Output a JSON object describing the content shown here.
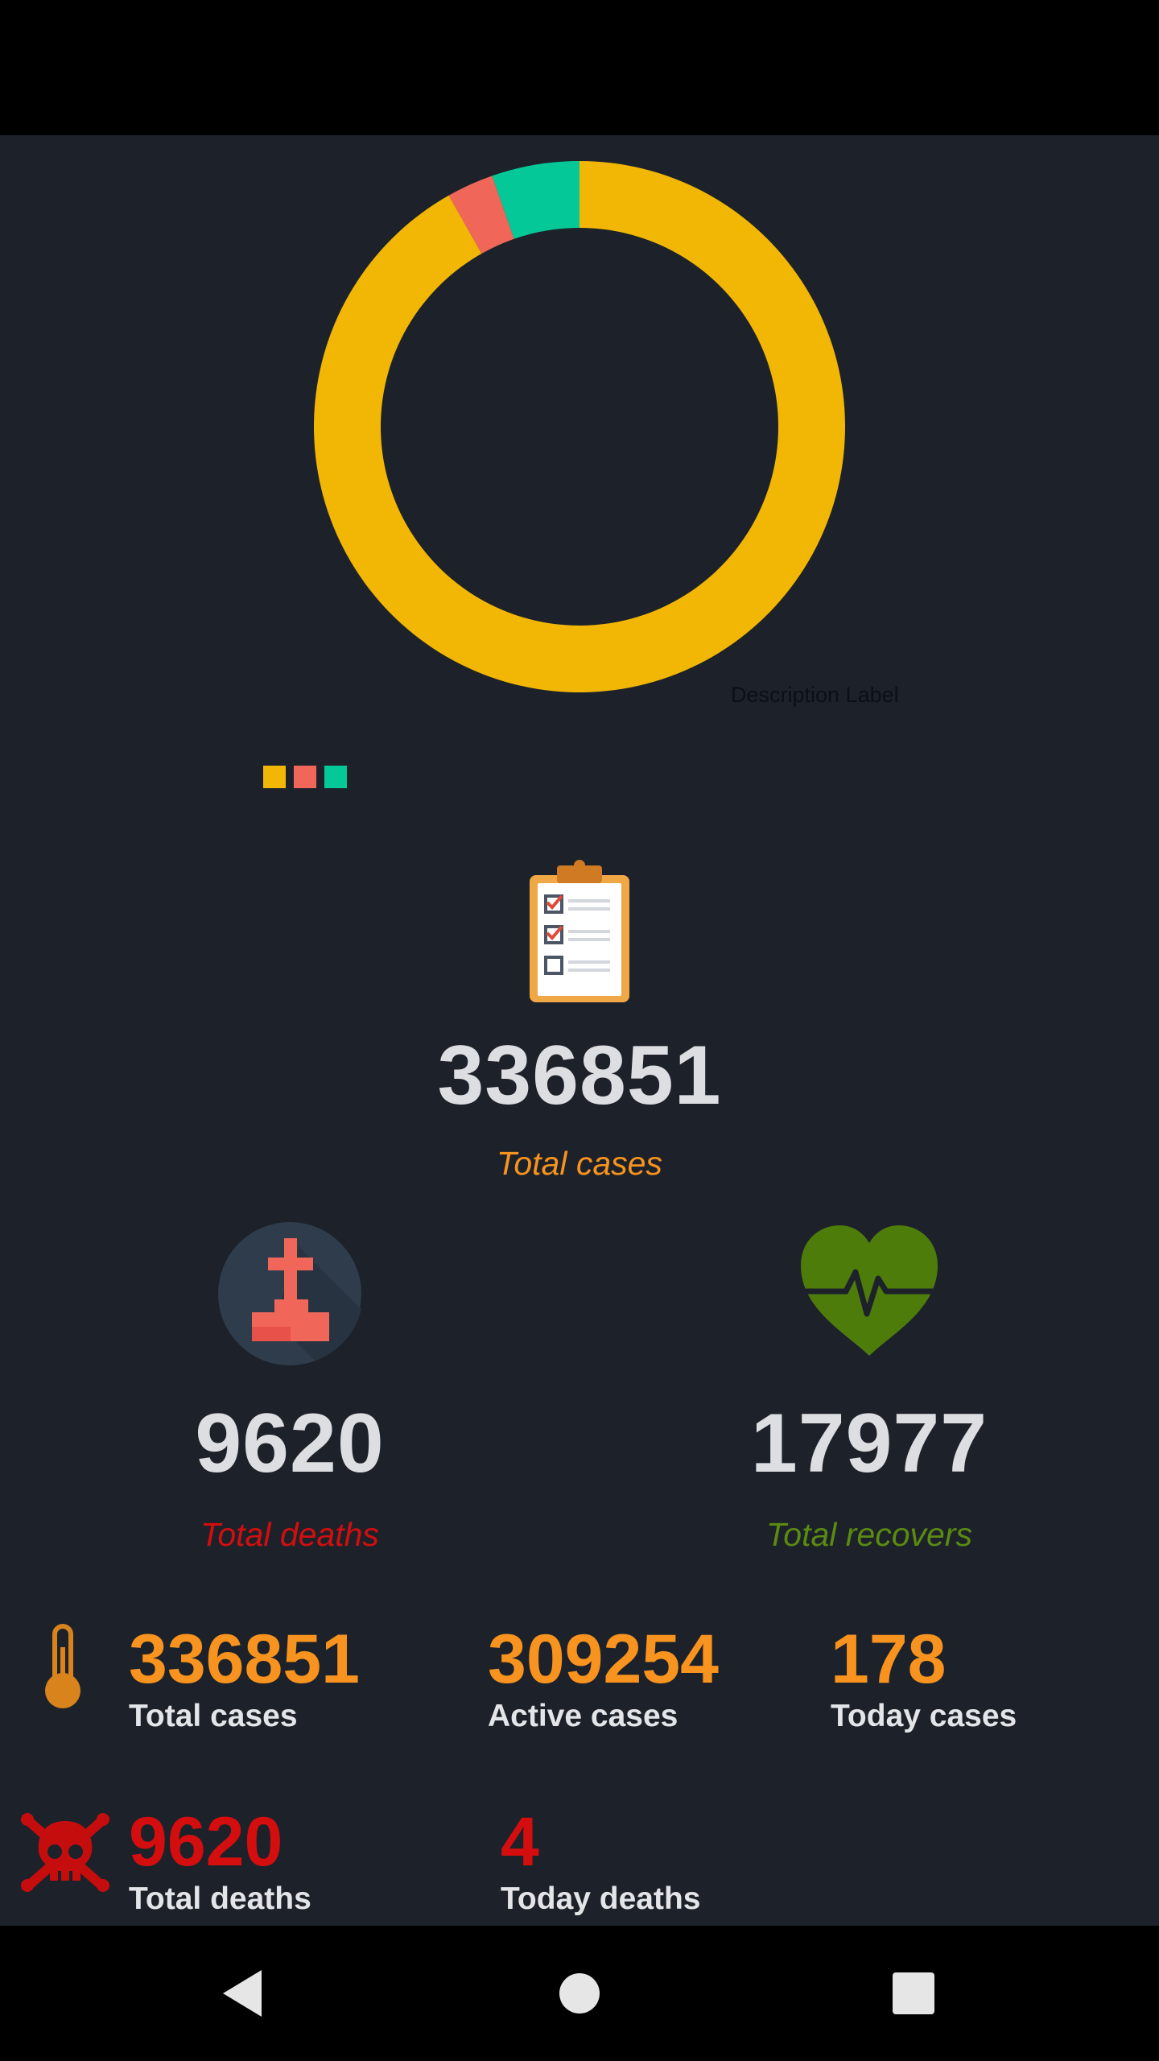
{
  "chart_data": {
    "type": "pie",
    "categories": [
      "",
      "",
      ""
    ],
    "values": [
      309254,
      9620,
      17977
    ],
    "colors": [
      "#f2b705",
      "#f0675a",
      "#04c897"
    ],
    "description": "Description Label"
  },
  "summary": {
    "total_cases": {
      "value": "336851",
      "label": "Total cases",
      "icon": "clipboard-icon"
    },
    "total_deaths": {
      "value": "9620",
      "label": "Total deaths",
      "icon": "grave-icon"
    },
    "total_recovers": {
      "value": "17977",
      "label": "Total recovers",
      "icon": "heartbeat-icon"
    }
  },
  "stats": {
    "row1": [
      {
        "value": "336851",
        "label": "Total cases"
      },
      {
        "value": "309254",
        "label": "Active cases"
      },
      {
        "value": "178",
        "label": "Today cases"
      }
    ],
    "row2": [
      {
        "value": "9620",
        "label": "Total deaths"
      },
      {
        "value": "4",
        "label": "Today deaths"
      }
    ]
  },
  "colors": {
    "background": "#1d222a",
    "cases_accent": "#f7931e",
    "deaths_accent": "#d40e0e",
    "recovers_accent": "#5a8a10"
  },
  "navigation": {
    "back": "back-icon",
    "home": "home-icon",
    "recents": "recents-icon"
  }
}
